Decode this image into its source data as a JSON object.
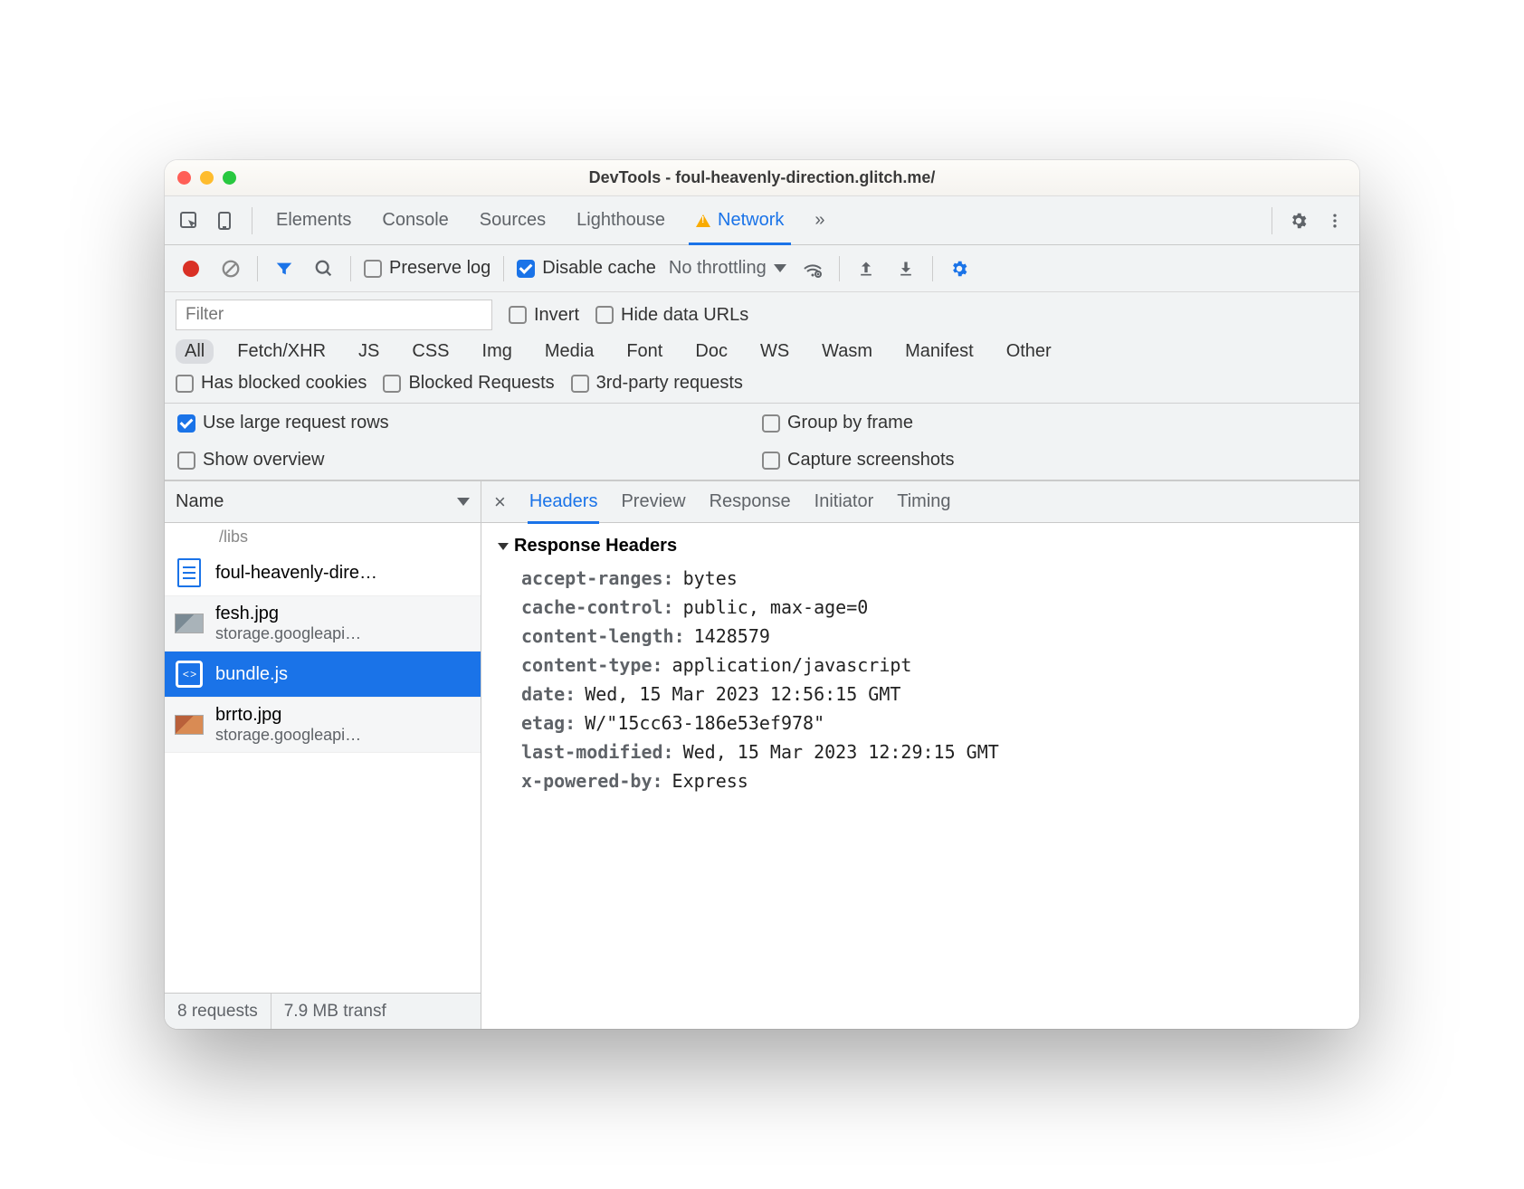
{
  "window": {
    "title": "DevTools - foul-heavenly-direction.glitch.me/"
  },
  "tabs": {
    "items": [
      "Elements",
      "Console",
      "Sources",
      "Lighthouse",
      "Network"
    ],
    "active": "Network",
    "more": "»"
  },
  "toolbar": {
    "preserve_log": "Preserve log",
    "disable_cache": "Disable cache",
    "throttling": "No throttling"
  },
  "filter": {
    "placeholder": "Filter",
    "invert": "Invert",
    "hide_data_urls": "Hide data URLs",
    "types": [
      "All",
      "Fetch/XHR",
      "JS",
      "CSS",
      "Img",
      "Media",
      "Font",
      "Doc",
      "WS",
      "Wasm",
      "Manifest",
      "Other"
    ],
    "has_blocked": "Has blocked cookies",
    "blocked_requests": "Blocked Requests",
    "third_party": "3rd-party requests"
  },
  "options": {
    "large_rows": "Use large request rows",
    "group_by_frame": "Group by frame",
    "show_overview": "Show overview",
    "capture_screenshots": "Capture screenshots"
  },
  "list": {
    "header": "Name",
    "preline": "/libs",
    "items": [
      {
        "name": "foul-heavenly-dire…",
        "sub": "",
        "kind": "doc"
      },
      {
        "name": "fesh.jpg",
        "sub": "storage.googleapi…",
        "kind": "img"
      },
      {
        "name": "bundle.js",
        "sub": "",
        "kind": "js",
        "selected": true
      },
      {
        "name": "brrto.jpg",
        "sub": "storage.googleapi…",
        "kind": "img2"
      }
    ]
  },
  "statusbar": {
    "requests": "8 requests",
    "transferred": "7.9 MB transf"
  },
  "details": {
    "tabs": [
      "Headers",
      "Preview",
      "Response",
      "Initiator",
      "Timing"
    ],
    "active": "Headers",
    "section": "Response Headers",
    "headers": [
      {
        "k": "accept-ranges",
        "v": "bytes"
      },
      {
        "k": "cache-control",
        "v": "public, max-age=0"
      },
      {
        "k": "content-length",
        "v": "1428579"
      },
      {
        "k": "content-type",
        "v": "application/javascript"
      },
      {
        "k": "date",
        "v": "Wed, 15 Mar 2023 12:56:15 GMT"
      },
      {
        "k": "etag",
        "v": "W/\"15cc63-186e53ef978\""
      },
      {
        "k": "last-modified",
        "v": "Wed, 15 Mar 2023 12:29:15 GMT"
      },
      {
        "k": "x-powered-by",
        "v": "Express"
      }
    ]
  }
}
